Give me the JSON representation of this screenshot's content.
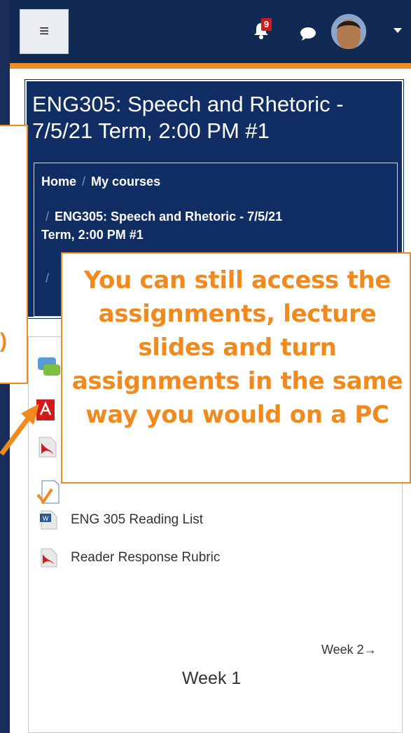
{
  "navbar": {
    "menu_icon": "hamburger-icon",
    "notification_count": "9",
    "chat_icon": "chat-bubble-icon",
    "caret_icon": "caret-down-icon"
  },
  "course": {
    "title": "ENG305: Speech and Rhetoric - 7/5/21 Term, 2:00 PM #1"
  },
  "breadcrumb": {
    "home": "Home",
    "my_courses": "My courses",
    "course_line1": "ENG305: Speech and Rhetoric - 7/5/21",
    "course_line2": "Term, 2:00 PM #1",
    "separator": "/"
  },
  "content": {
    "items": [
      {
        "label": "ENG 305 Reading List",
        "icon": "word-doc-icon"
      },
      {
        "label": "Reader Response Rubric",
        "icon": "pdf-icon"
      }
    ],
    "week_nav": "Week 2→",
    "week_title": "Week 1"
  },
  "callout": {
    "text": "You can still access the assignments, lecture slides and turn assignments in the same way you would on a PC"
  },
  "colors": {
    "navy": "#102e63",
    "orange": "#f08a1e"
  }
}
